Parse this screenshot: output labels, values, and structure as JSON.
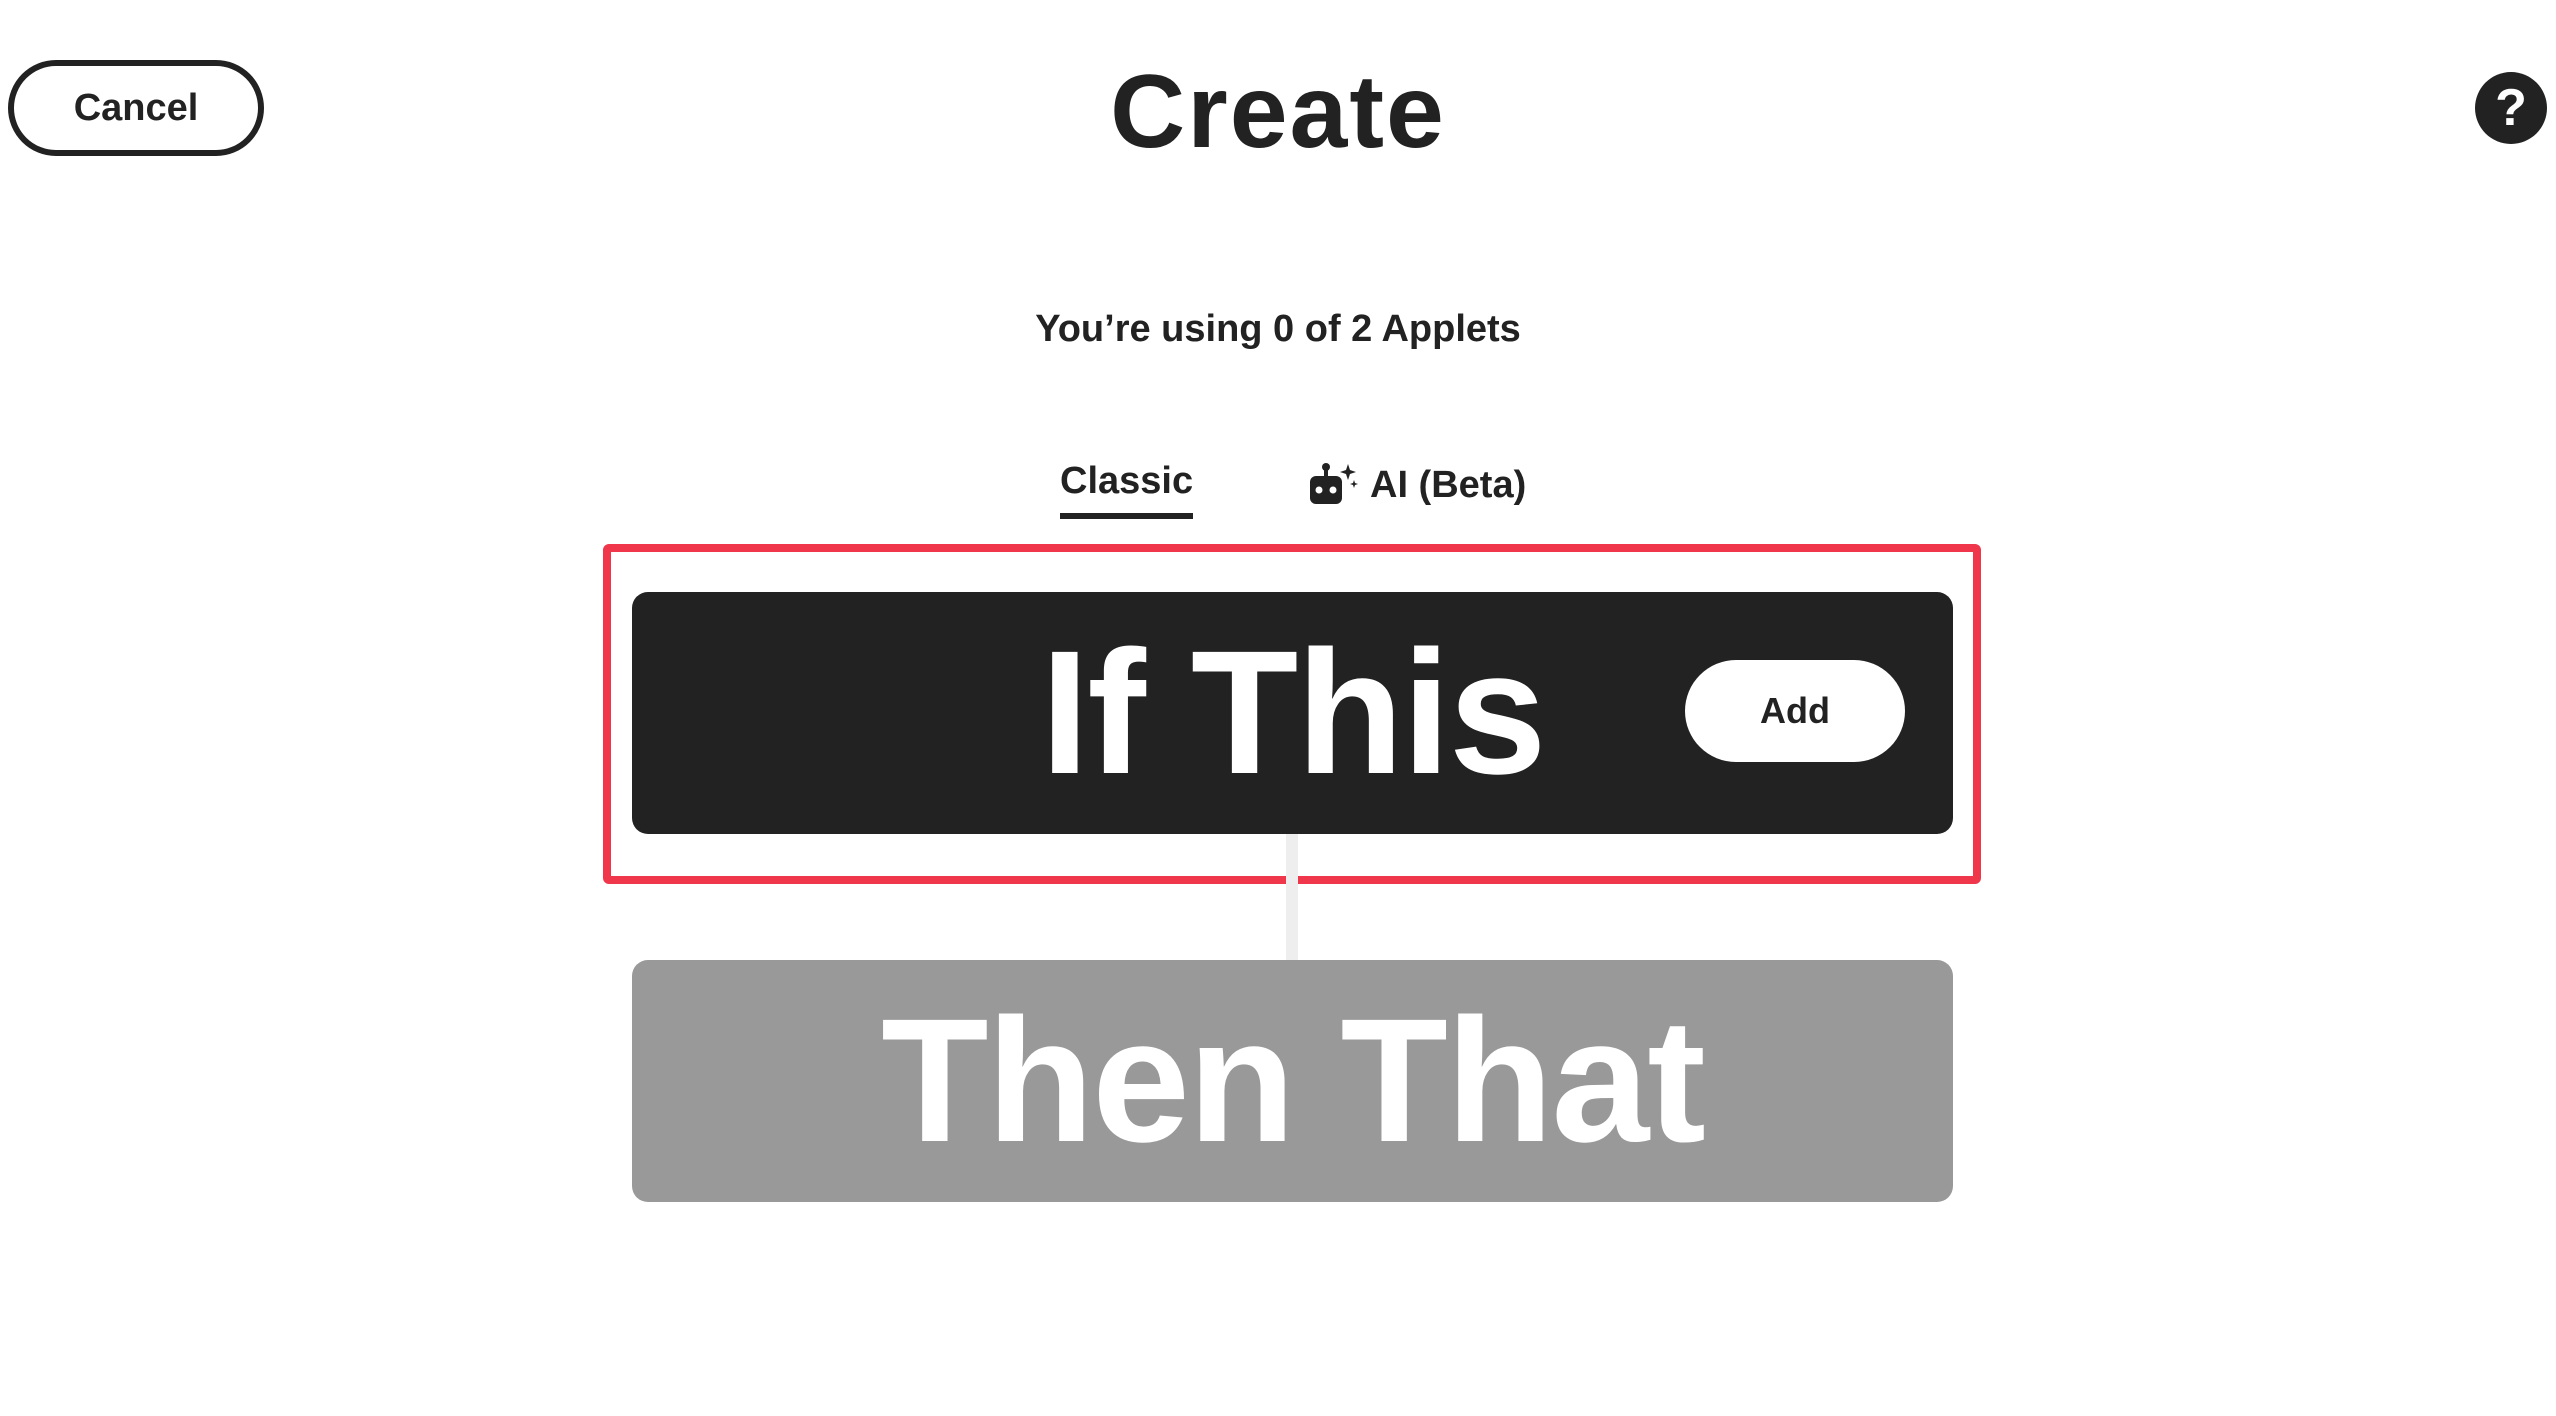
{
  "header": {
    "cancel_label": "Cancel",
    "title": "Create",
    "help_label": "?"
  },
  "usage": {
    "text": "You’re using 0 of 2 Applets"
  },
  "tabs": [
    {
      "label": "Classic",
      "active": true
    },
    {
      "label": "AI (Beta)",
      "active": false,
      "icon": "robot-sparkle-icon"
    }
  ],
  "trigger": {
    "label": "If This",
    "add_label": "Add"
  },
  "action": {
    "label": "Then That"
  },
  "colors": {
    "dark": "#222222",
    "disabled": "#999999",
    "highlight": "#f0364a",
    "connector": "#eeeeee"
  }
}
